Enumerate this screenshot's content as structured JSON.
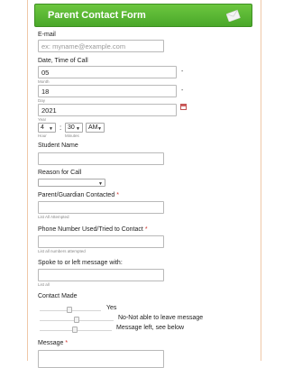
{
  "form": {
    "title": "Parent Contact Form"
  },
  "email": {
    "label": "E-mail",
    "placeholder": "ex: myname@example.com"
  },
  "datetime": {
    "label": "Date, Time of Call",
    "month_value": "05",
    "month_sub": "Month",
    "day_value": "18",
    "day_sub": "Day",
    "year_value": "2021",
    "year_sub": "Year",
    "separator": "-",
    "hour_value": "4",
    "hour_sub": "Hour",
    "minute_value": "30",
    "minute_sub": "Minutes",
    "ampm_value": "AM",
    "time_separator": ":"
  },
  "student": {
    "label": "Student Name"
  },
  "reason": {
    "label": "Reason for Call",
    "selected": ""
  },
  "guardian": {
    "label": "Parent/Guardian Contacted",
    "required_mark": "*",
    "sub": "List All Attempted"
  },
  "phone": {
    "label": "Phone Number Used/Tried to Contact",
    "required_mark": "*",
    "sub": "List all numbers attempted"
  },
  "spoke": {
    "label": "Spoke to or left message with:",
    "sub": "List all"
  },
  "contact_made": {
    "label": "Contact Made",
    "options": [
      "Yes",
      "No-Not able to leave message",
      "Message left, see below"
    ]
  },
  "message": {
    "label": "Message",
    "required_mark": "*"
  },
  "colors": {
    "header_green": "#5bb934",
    "required_red": "#d0302b",
    "frame_border": "#f0c8a8"
  }
}
